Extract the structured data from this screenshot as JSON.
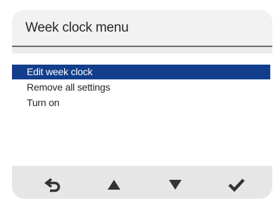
{
  "header": {
    "title": "Week clock menu"
  },
  "menu": {
    "items": [
      {
        "label": "Edit week clock",
        "selected": true
      },
      {
        "label": "Remove all settings",
        "selected": false
      },
      {
        "label": "Turn on",
        "selected": false
      }
    ]
  },
  "nav": {
    "buttons": [
      {
        "icon": "back-arrow-icon"
      },
      {
        "icon": "up-arrow-icon"
      },
      {
        "icon": "down-arrow-icon"
      },
      {
        "icon": "checkmark-icon"
      }
    ]
  },
  "colors": {
    "selection": "#123e8c",
    "icon": "#333333",
    "background": "#ececec"
  }
}
